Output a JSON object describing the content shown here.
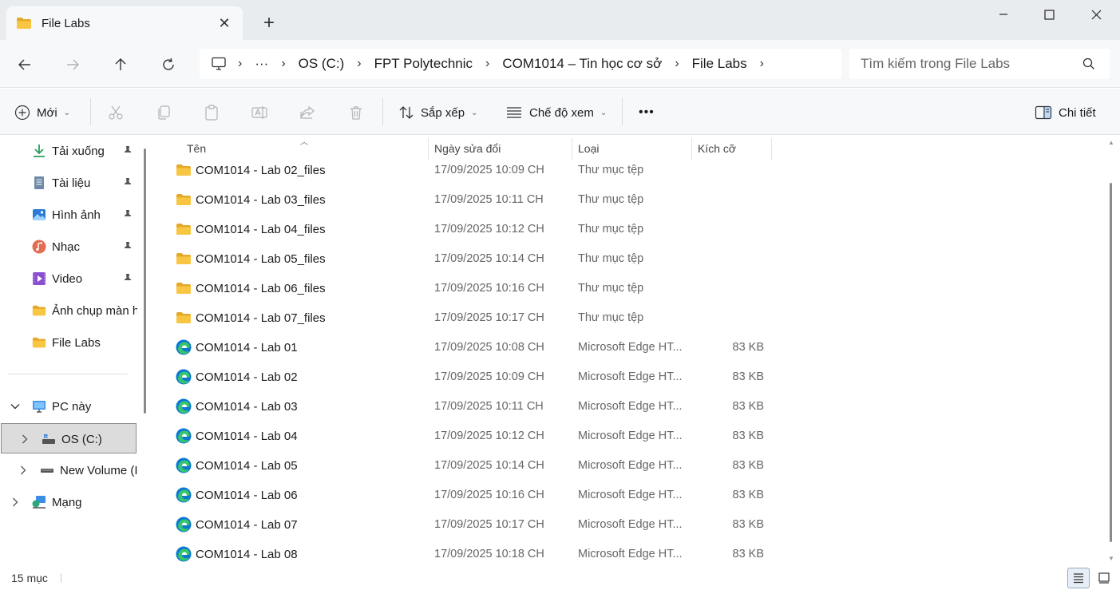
{
  "window": {
    "tab_title": "File Labs",
    "new_tab_symbol": "+",
    "close_symbol": "✕"
  },
  "breadcrumb": {
    "more": "···",
    "items": [
      "OS (C:)",
      "FPT Polytechnic",
      "COM1014 – Tin học cơ sở",
      "File Labs"
    ]
  },
  "search": {
    "placeholder": "Tìm kiếm trong File Labs"
  },
  "toolbar": {
    "new_label": "Mới",
    "sort_label": "Sắp xếp",
    "view_label": "Chế độ xem",
    "more_label": "•••",
    "details_label": "Chi tiết"
  },
  "navpane": {
    "quick": [
      {
        "label": "Tải xuống",
        "icon": "download-icon"
      },
      {
        "label": "Tài liệu",
        "icon": "document-icon"
      },
      {
        "label": "Hình ảnh",
        "icon": "pictures-icon"
      },
      {
        "label": "Nhạc",
        "icon": "music-icon"
      },
      {
        "label": "Video",
        "icon": "video-icon"
      },
      {
        "label": "Ảnh chụp màn h",
        "icon": "folder-icon"
      },
      {
        "label": "File Labs",
        "icon": "folder-icon"
      }
    ],
    "pc_label": "PC này",
    "drive_c_label": "OS (C:)",
    "new_volume_label": "New Volume (I",
    "network_label": "Mạng"
  },
  "columns": {
    "name": "Tên",
    "date": "Ngày sửa đổi",
    "type": "Loại",
    "size": "Kích cỡ"
  },
  "files": [
    {
      "name": "COM1014 - Lab 02_files",
      "date": "17/09/2025 10:09 CH",
      "type": "Thư mục tệp",
      "size": "",
      "kind": "folder"
    },
    {
      "name": "COM1014 - Lab 03_files",
      "date": "17/09/2025 10:11 CH",
      "type": "Thư mục tệp",
      "size": "",
      "kind": "folder"
    },
    {
      "name": "COM1014 - Lab 04_files",
      "date": "17/09/2025 10:12 CH",
      "type": "Thư mục tệp",
      "size": "",
      "kind": "folder"
    },
    {
      "name": "COM1014 - Lab 05_files",
      "date": "17/09/2025 10:14 CH",
      "type": "Thư mục tệp",
      "size": "",
      "kind": "folder"
    },
    {
      "name": "COM1014 - Lab 06_files",
      "date": "17/09/2025 10:16 CH",
      "type": "Thư mục tệp",
      "size": "",
      "kind": "folder"
    },
    {
      "name": "COM1014 - Lab 07_files",
      "date": "17/09/2025 10:17 CH",
      "type": "Thư mục tệp",
      "size": "",
      "kind": "folder"
    },
    {
      "name": "COM1014 - Lab 01",
      "date": "17/09/2025 10:08 CH",
      "type": "Microsoft Edge HT...",
      "size": "83 KB",
      "kind": "edge"
    },
    {
      "name": "COM1014 - Lab 02",
      "date": "17/09/2025 10:09 CH",
      "type": "Microsoft Edge HT...",
      "size": "83 KB",
      "kind": "edge"
    },
    {
      "name": "COM1014 - Lab 03",
      "date": "17/09/2025 10:11 CH",
      "type": "Microsoft Edge HT...",
      "size": "83 KB",
      "kind": "edge"
    },
    {
      "name": "COM1014 - Lab 04",
      "date": "17/09/2025 10:12 CH",
      "type": "Microsoft Edge HT...",
      "size": "83 KB",
      "kind": "edge"
    },
    {
      "name": "COM1014 - Lab 05",
      "date": "17/09/2025 10:14 CH",
      "type": "Microsoft Edge HT...",
      "size": "83 KB",
      "kind": "edge"
    },
    {
      "name": "COM1014 - Lab 06",
      "date": "17/09/2025 10:16 CH",
      "type": "Microsoft Edge HT...",
      "size": "83 KB",
      "kind": "edge"
    },
    {
      "name": "COM1014 - Lab 07",
      "date": "17/09/2025 10:17 CH",
      "type": "Microsoft Edge HT...",
      "size": "83 KB",
      "kind": "edge"
    },
    {
      "name": "COM1014 - Lab 08",
      "date": "17/09/2025 10:18 CH",
      "type": "Microsoft Edge HT...",
      "size": "83 KB",
      "kind": "edge"
    }
  ],
  "status": {
    "count": "15 mục"
  },
  "colors": {
    "folder": "#f8c642",
    "folder_dark": "#e5a92a",
    "edge_blue": "#0c78d4",
    "edge_green": "#37c56e"
  }
}
